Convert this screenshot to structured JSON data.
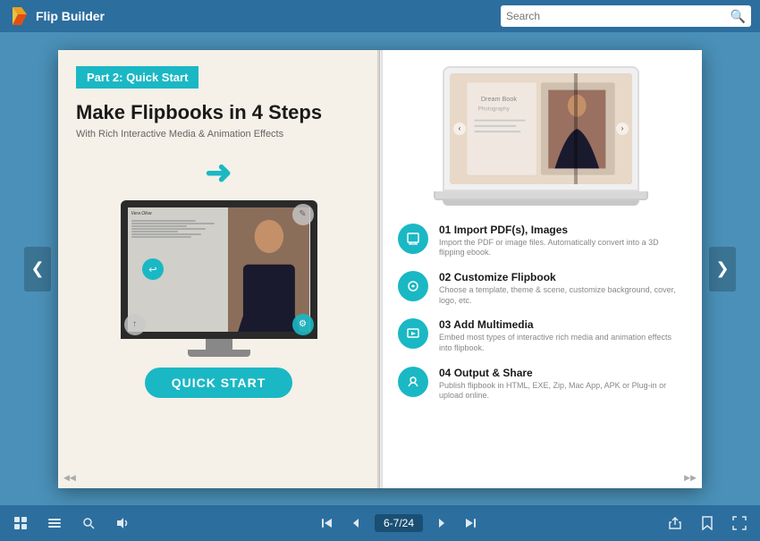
{
  "header": {
    "logo_text": "Flip Builder",
    "search_placeholder": "Search"
  },
  "left_page": {
    "part_badge": "Part 2: Quick Start",
    "main_title": "Make Flipbooks in 4 Steps",
    "subtitle": "With Rich Interactive Media & Animation Effects",
    "quickstart_btn": "QUICK START"
  },
  "right_page": {
    "steps": [
      {
        "number": "01",
        "title": "Import PDF(s), Images",
        "desc": "Import the PDF or image files. Automatically convert into a 3D flipping ebook.",
        "icon": "📥"
      },
      {
        "number": "02",
        "title": "Customize Flipbook",
        "desc": "Choose a template, theme & scene, customize background, cover, logo, etc.",
        "icon": "🎨"
      },
      {
        "number": "03",
        "title": "Add Multimedia",
        "desc": "Embed most types of interactive rich media and animation effects into flipbook.",
        "icon": "🎬"
      },
      {
        "number": "04",
        "title": "Output & Share",
        "desc": "Publish flipbook in HTML, EXE, Zip, Mac App, APK or Plug-in or upload online.",
        "icon": "📤"
      }
    ]
  },
  "toolbar": {
    "page_indicator": "6-7/24",
    "icons": {
      "grid": "⊞",
      "list": "≡",
      "zoom": "🔍",
      "sound": "🔊",
      "first": "⏮",
      "prev": "◀",
      "next": "▶",
      "last": "⏭",
      "share": "↑",
      "bookmark": "🔖",
      "fullscreen": "⛶"
    }
  },
  "nav": {
    "left_arrow": "❮",
    "right_arrow": "❯"
  }
}
